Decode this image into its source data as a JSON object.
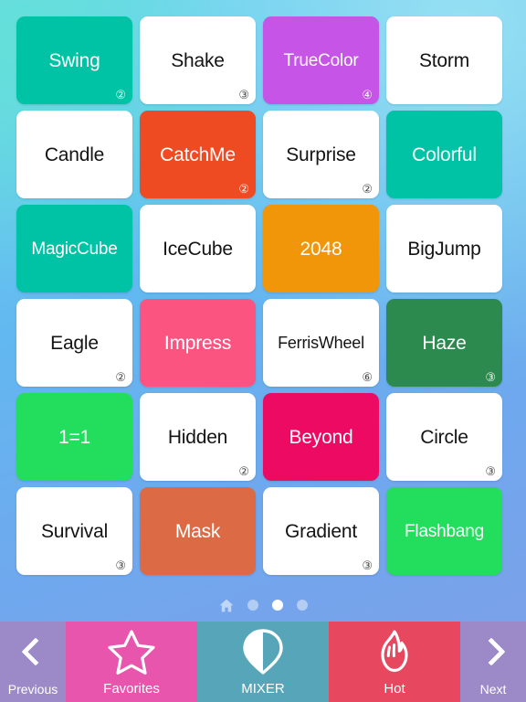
{
  "app": {
    "background_top": "#6fd8f0",
    "background_bottom": "#7e9fe8"
  },
  "grid": {
    "columns": 4,
    "rows": 6,
    "tiles": [
      {
        "label": "Swing",
        "badge": "②",
        "bg": "#00c3a5",
        "text": "light"
      },
      {
        "label": "Shake",
        "badge": "③",
        "bg": "#ffffff",
        "text": "dark"
      },
      {
        "label": "TrueColor",
        "badge": "④",
        "bg": "#c655e7",
        "text": "light"
      },
      {
        "label": "Storm",
        "badge": "",
        "bg": "#ffffff",
        "text": "dark"
      },
      {
        "label": "Candle",
        "badge": "",
        "bg": "#ffffff",
        "text": "dark"
      },
      {
        "label": "CatchMe",
        "badge": "②",
        "bg": "#ef4b23",
        "text": "light"
      },
      {
        "label": "Surprise",
        "badge": "②",
        "bg": "#ffffff",
        "text": "dark"
      },
      {
        "label": "Colorful",
        "badge": "",
        "bg": "#00c3a5",
        "text": "light"
      },
      {
        "label": "MagicCube",
        "badge": "",
        "bg": "#00c3a5",
        "text": "light"
      },
      {
        "label": "IceCube",
        "badge": "",
        "bg": "#ffffff",
        "text": "dark"
      },
      {
        "label": "2048",
        "badge": "",
        "bg": "#f09608",
        "text": "light"
      },
      {
        "label": "BigJump",
        "badge": "",
        "bg": "#ffffff",
        "text": "dark"
      },
      {
        "label": "Eagle",
        "badge": "②",
        "bg": "#ffffff",
        "text": "dark"
      },
      {
        "label": "Impress",
        "badge": "",
        "bg": "#fc5480",
        "text": "light"
      },
      {
        "label": "FerrisWheel",
        "badge": "⑥",
        "bg": "#ffffff",
        "text": "dark"
      },
      {
        "label": "Haze",
        "badge": "③",
        "bg": "#2d8a4e",
        "text": "light"
      },
      {
        "label": "1=1",
        "badge": "",
        "bg": "#22de5c",
        "text": "light"
      },
      {
        "label": "Hidden",
        "badge": "②",
        "bg": "#ffffff",
        "text": "dark"
      },
      {
        "label": "Beyond",
        "badge": "",
        "bg": "#ed0a63",
        "text": "light"
      },
      {
        "label": "Circle",
        "badge": "③",
        "bg": "#ffffff",
        "text": "dark"
      },
      {
        "label": "Survival",
        "badge": "③",
        "bg": "#ffffff",
        "text": "dark"
      },
      {
        "label": "Mask",
        "badge": "",
        "bg": "#dc6b45",
        "text": "light"
      },
      {
        "label": "Gradient",
        "badge": "③",
        "bg": "#ffffff",
        "text": "dark"
      },
      {
        "label": "Flashbang",
        "badge": "",
        "bg": "#22de5c",
        "text": "light"
      }
    ]
  },
  "pager": {
    "home_icon": "home-icon",
    "dot_count": 3,
    "active_index": 1
  },
  "toolbar": {
    "items": [
      {
        "label": "Previous",
        "icon": "chevron-left-icon",
        "color": "#9b89c8"
      },
      {
        "label": "Favorites",
        "icon": "star-icon",
        "color": "#e755ac"
      },
      {
        "label": "MIXER",
        "icon": "droplet-half-icon",
        "color": "#56a5b8"
      },
      {
        "label": "Hot",
        "icon": "flame-icon",
        "color": "#e8485f"
      },
      {
        "label": "Next",
        "icon": "chevron-right-icon",
        "color": "#9b89c8"
      }
    ]
  }
}
